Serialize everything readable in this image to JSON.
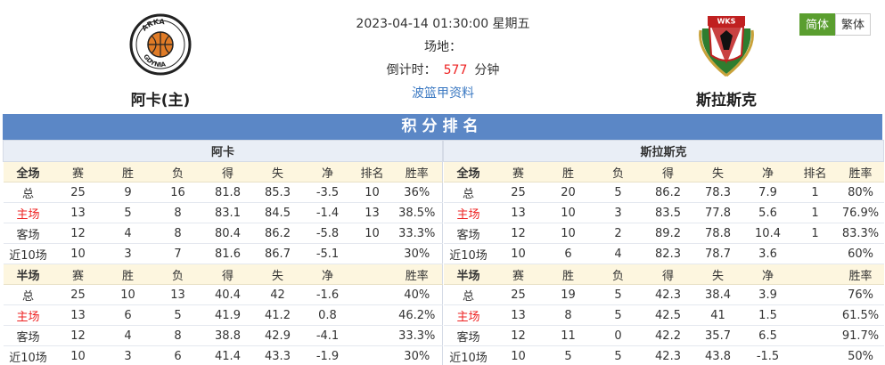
{
  "home_team": {
    "name": "阿卡(主)",
    "logo_text": "ARKA GDYNIA",
    "logo_icon": "basketball-icon"
  },
  "away_team": {
    "name": "斯拉斯克",
    "logo_text": "WKS",
    "logo_icon": "eagle-crest-icon"
  },
  "match": {
    "datetime": "2023-04-14 01:30:00 星期五",
    "venue_label": "场地：",
    "countdown_label": "倒计时：",
    "countdown_value": "577",
    "countdown_unit": "分钟",
    "league": "波篮甲资料"
  },
  "lang": {
    "simplified": "简体",
    "traditional": "繁体"
  },
  "section_title": "积分排名",
  "colors": {
    "header_blue": "#5b87c6",
    "lang_active": "#5a9e2f",
    "highlight_red": "#e22222"
  },
  "standings": {
    "left": {
      "team": "阿卡",
      "full_header": [
        "全场",
        "赛",
        "胜",
        "负",
        "得",
        "失",
        "净",
        "排名",
        "胜率"
      ],
      "full_rows": [
        [
          "总",
          "25",
          "9",
          "16",
          "81.8",
          "85.3",
          "-3.5",
          "10",
          "36%"
        ],
        [
          "主场",
          "13",
          "5",
          "8",
          "83.1",
          "84.5",
          "-1.4",
          "13",
          "38.5%"
        ],
        [
          "客场",
          "12",
          "4",
          "8",
          "80.4",
          "86.2",
          "-5.8",
          "10",
          "33.3%"
        ],
        [
          "近10场",
          "10",
          "3",
          "7",
          "81.6",
          "86.7",
          "-5.1",
          "",
          "30%"
        ]
      ],
      "half_header": [
        "半场",
        "赛",
        "胜",
        "负",
        "得",
        "失",
        "净",
        "",
        "胜率"
      ],
      "half_rows": [
        [
          "总",
          "25",
          "10",
          "13",
          "40.4",
          "42",
          "-1.6",
          "",
          "40%"
        ],
        [
          "主场",
          "13",
          "6",
          "5",
          "41.9",
          "41.2",
          "0.8",
          "",
          "46.2%"
        ],
        [
          "客场",
          "12",
          "4",
          "8",
          "38.8",
          "42.9",
          "-4.1",
          "",
          "33.3%"
        ],
        [
          "近10场",
          "10",
          "3",
          "6",
          "41.4",
          "43.3",
          "-1.9",
          "",
          "30%"
        ]
      ]
    },
    "right": {
      "team": "斯拉斯克",
      "full_header": [
        "全场",
        "赛",
        "胜",
        "负",
        "得",
        "失",
        "净",
        "排名",
        "胜率"
      ],
      "full_rows": [
        [
          "总",
          "25",
          "20",
          "5",
          "86.2",
          "78.3",
          "7.9",
          "1",
          "80%"
        ],
        [
          "主场",
          "13",
          "10",
          "3",
          "83.5",
          "77.8",
          "5.6",
          "1",
          "76.9%"
        ],
        [
          "客场",
          "12",
          "10",
          "2",
          "89.2",
          "78.8",
          "10.4",
          "1",
          "83.3%"
        ],
        [
          "近10场",
          "10",
          "6",
          "4",
          "82.3",
          "78.7",
          "3.6",
          "",
          "60%"
        ]
      ],
      "half_header": [
        "半场",
        "赛",
        "胜",
        "负",
        "得",
        "失",
        "净",
        "",
        "胜率"
      ],
      "half_rows": [
        [
          "总",
          "25",
          "19",
          "5",
          "42.3",
          "38.4",
          "3.9",
          "",
          "76%"
        ],
        [
          "主场",
          "13",
          "8",
          "5",
          "42.5",
          "41",
          "1.5",
          "",
          "61.5%"
        ],
        [
          "客场",
          "12",
          "11",
          "0",
          "42.2",
          "35.7",
          "6.5",
          "",
          "91.7%"
        ],
        [
          "近10场",
          "10",
          "5",
          "5",
          "42.3",
          "43.8",
          "-1.5",
          "",
          "50%"
        ]
      ]
    }
  }
}
